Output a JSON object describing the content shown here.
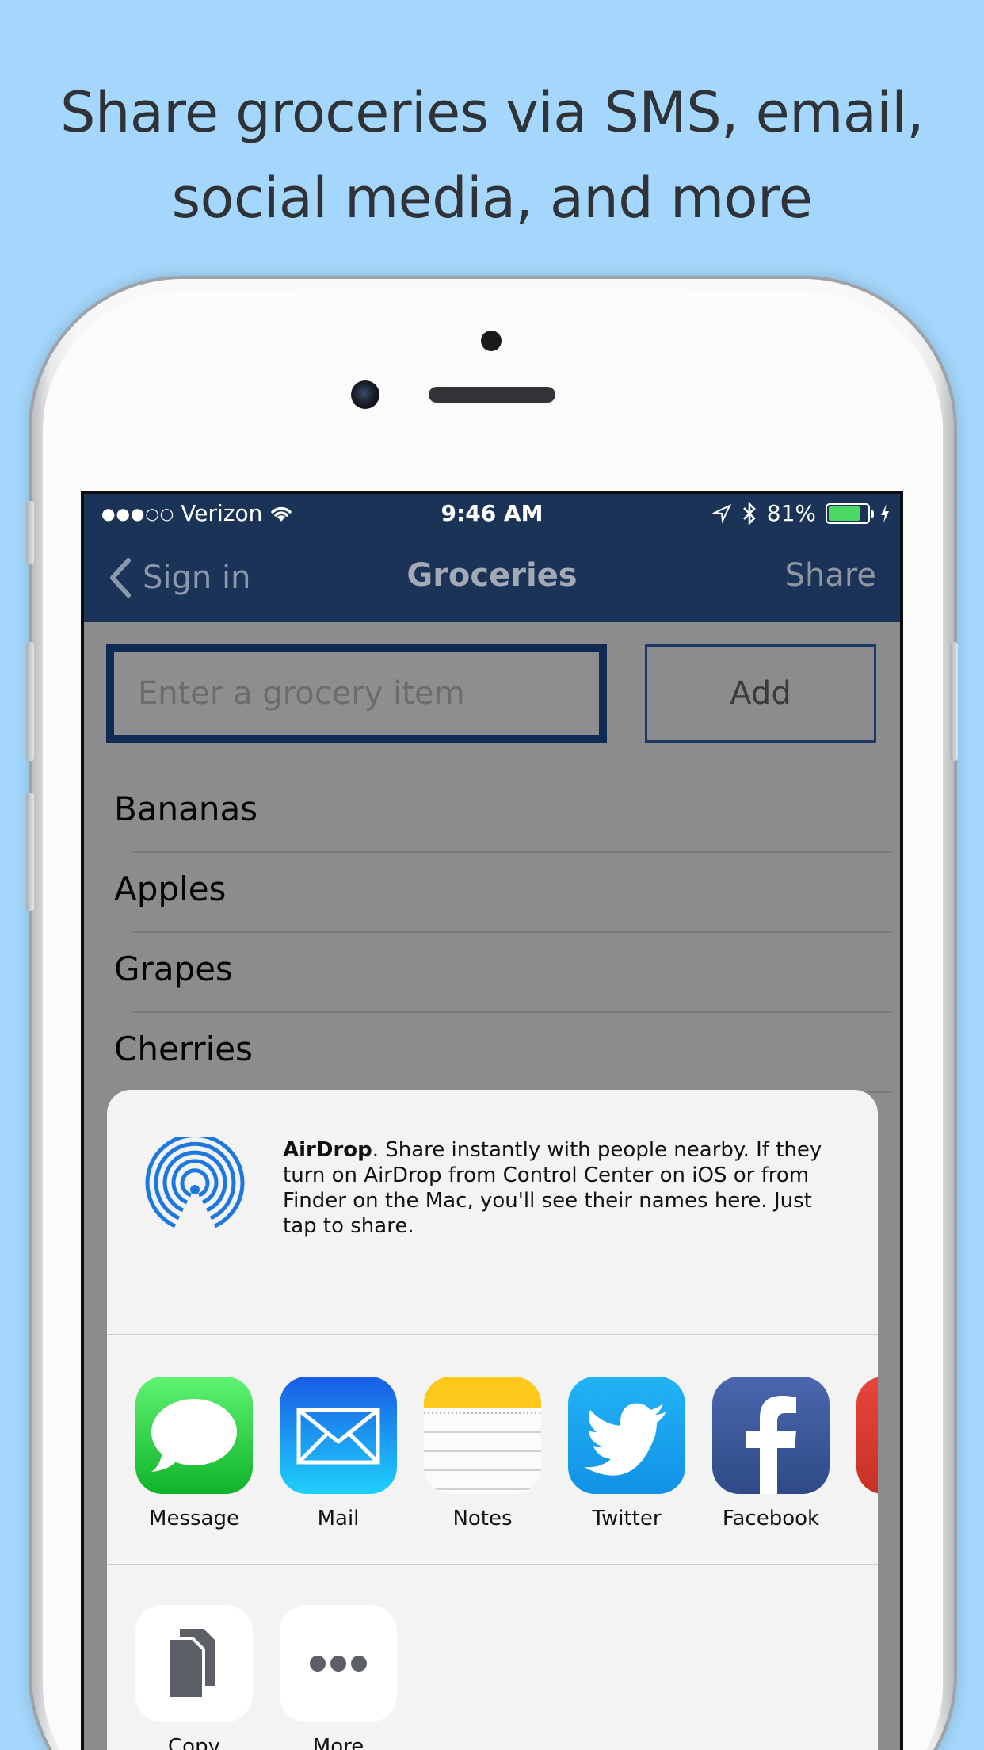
{
  "headline": {
    "line1": "Share groceries via SMS, email,",
    "line2": "social media, and more"
  },
  "statusbar": {
    "signal": "●●●○○",
    "carrier": "Verizon",
    "time": "9:46 AM",
    "battery": "81%",
    "battery_level": 0.81
  },
  "navbar": {
    "back_label": "Sign in",
    "title": "Groceries",
    "share_label": "Share"
  },
  "entry": {
    "placeholder": "Enter a grocery item",
    "add_label": "Add"
  },
  "groceries": [
    "Bananas",
    "Apples",
    "Grapes",
    "Cherries"
  ],
  "share_sheet": {
    "airdrop_title": "AirDrop",
    "airdrop_text": ". Share instantly with people nearby. If they turn on AirDrop from Control Center on iOS or from Finder on the Mac, you'll see their names here. Just tap to share.",
    "apps": [
      {
        "label": "Message",
        "icon": "message-icon",
        "color": "#29c240"
      },
      {
        "label": "Mail",
        "icon": "mail-icon",
        "color": "#1e88f0"
      },
      {
        "label": "Notes",
        "icon": "notes-icon",
        "color": "#ffd21a"
      },
      {
        "label": "Twitter",
        "icon": "twitter-icon",
        "color": "#1da1f2"
      },
      {
        "label": "Facebook",
        "icon": "facebook-icon",
        "color": "#3b5998"
      }
    ],
    "actions": [
      {
        "label": "Copy",
        "icon": "copy-icon"
      },
      {
        "label": "More",
        "icon": "more-icon"
      }
    ]
  }
}
